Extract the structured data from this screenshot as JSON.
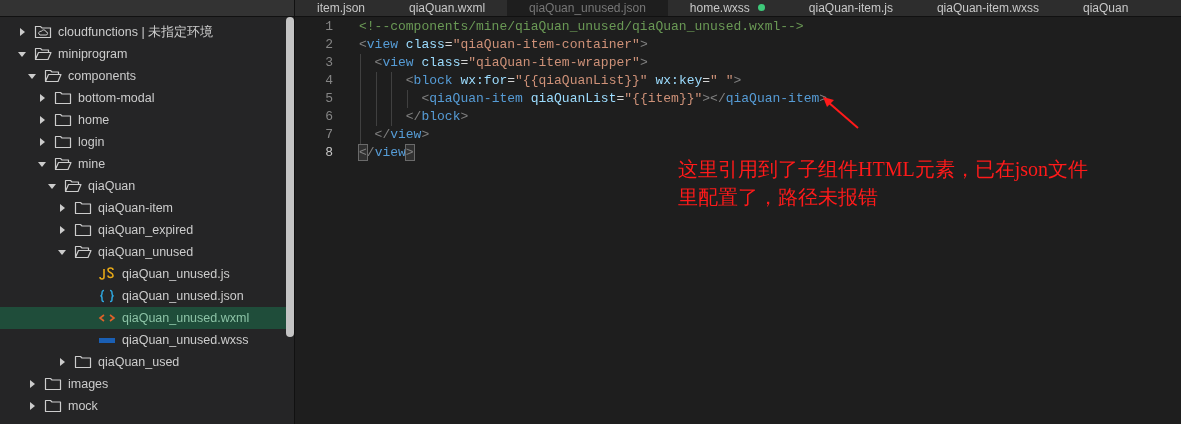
{
  "editor_tabs": [
    {
      "label": "item.json",
      "selected": false,
      "modified": false
    },
    {
      "label": "qiaQuan.wxml",
      "selected": false,
      "modified": false
    },
    {
      "label": "qiaQuan_unused.json",
      "selected": true,
      "modified": false
    },
    {
      "label": "home.wxss",
      "selected": false,
      "modified": true
    },
    {
      "label": "qiaQuan-item.js",
      "selected": false,
      "modified": false
    },
    {
      "label": "qiaQuan-item.wxss",
      "selected": false,
      "modified": false
    },
    {
      "label": "qiaQuan",
      "selected": false,
      "modified": false
    }
  ],
  "file_tree": [
    {
      "label": "cloudfunctions | 未指定环境",
      "kind": "cloud_folder",
      "expanded": false,
      "selected": false
    },
    {
      "label": "miniprogram",
      "kind": "folder",
      "expanded": true,
      "selected": false,
      "children": [
        {
          "label": "components",
          "kind": "folder",
          "expanded": true,
          "selected": false,
          "children": [
            {
              "label": "bottom-modal",
              "kind": "folder",
              "expanded": false,
              "selected": false
            },
            {
              "label": "home",
              "kind": "folder",
              "expanded": false,
              "selected": false
            },
            {
              "label": "login",
              "kind": "folder",
              "expanded": false,
              "selected": false
            },
            {
              "label": "mine",
              "kind": "folder",
              "expanded": true,
              "selected": false,
              "children": [
                {
                  "label": "qiaQuan",
                  "kind": "folder",
                  "expanded": true,
                  "selected": false,
                  "children": [
                    {
                      "label": "qiaQuan-item",
                      "kind": "folder",
                      "expanded": false,
                      "selected": false
                    },
                    {
                      "label": "qiaQuan_expired",
                      "kind": "folder",
                      "expanded": false,
                      "selected": false
                    },
                    {
                      "label": "qiaQuan_unused",
                      "kind": "folder",
                      "expanded": true,
                      "selected": false,
                      "children": [
                        {
                          "label": "qiaQuan_unused.js",
                          "kind": "js",
                          "selected": false
                        },
                        {
                          "label": "qiaQuan_unused.json",
                          "kind": "json",
                          "selected": false
                        },
                        {
                          "label": "qiaQuan_unused.wxml",
                          "kind": "wxml",
                          "selected": true
                        },
                        {
                          "label": "qiaQuan_unused.wxss",
                          "kind": "wxss",
                          "selected": false
                        }
                      ]
                    },
                    {
                      "label": "qiaQuan_used",
                      "kind": "folder",
                      "expanded": false,
                      "selected": false
                    }
                  ]
                }
              ]
            }
          ]
        },
        {
          "label": "images",
          "kind": "folder",
          "expanded": false,
          "selected": false
        },
        {
          "label": "mock",
          "kind": "folder",
          "expanded": false,
          "selected": false
        }
      ]
    }
  ],
  "code_lines": [
    {
      "number": "1",
      "current": false,
      "tokens": [
        {
          "kind": "comment",
          "text": "<!--components/mine/qiaQuan_unused/qiaQuan_unused.wxml-->"
        }
      ]
    },
    {
      "number": "2",
      "current": false,
      "tokens": [
        {
          "kind": "punct",
          "text": "<"
        },
        {
          "kind": "tag",
          "text": "view"
        },
        {
          "kind": "attr",
          "text": " class"
        },
        {
          "kind": "plain",
          "text": "="
        },
        {
          "kind": "string",
          "text": "\"qiaQuan-item-container\""
        },
        {
          "kind": "punct",
          "text": ">"
        }
      ]
    },
    {
      "number": "3",
      "current": false,
      "tokens": [
        {
          "kind": "punct",
          "text": "  <"
        },
        {
          "kind": "tag",
          "text": "view"
        },
        {
          "kind": "attr",
          "text": " class"
        },
        {
          "kind": "plain",
          "text": "="
        },
        {
          "kind": "string",
          "text": "\"qiaQuan-item-wrapper\""
        },
        {
          "kind": "punct",
          "text": ">"
        }
      ]
    },
    {
      "number": "4",
      "current": false,
      "tokens": [
        {
          "kind": "punct",
          "text": "      <"
        },
        {
          "kind": "tag",
          "text": "block"
        },
        {
          "kind": "attr",
          "text": " wx:for"
        },
        {
          "kind": "plain",
          "text": "="
        },
        {
          "kind": "string",
          "text": "\"{{qiaQuanList}}\""
        },
        {
          "kind": "attr",
          "text": " wx:key"
        },
        {
          "kind": "plain",
          "text": "="
        },
        {
          "kind": "string",
          "text": "\" \""
        },
        {
          "kind": "punct",
          "text": ">"
        }
      ]
    },
    {
      "number": "5",
      "current": false,
      "tokens": [
        {
          "kind": "punct",
          "text": "        <"
        },
        {
          "kind": "tag",
          "text": "qiaQuan-item"
        },
        {
          "kind": "attr",
          "text": " qiaQuanList"
        },
        {
          "kind": "plain",
          "text": "="
        },
        {
          "kind": "string",
          "text": "\"{{item}}\""
        },
        {
          "kind": "punct",
          "text": "></"
        },
        {
          "kind": "tag",
          "text": "qiaQuan-item"
        },
        {
          "kind": "punct",
          "text": ">"
        }
      ]
    },
    {
      "number": "6",
      "current": false,
      "tokens": [
        {
          "kind": "punct",
          "text": "      </"
        },
        {
          "kind": "tag",
          "text": "block"
        },
        {
          "kind": "punct",
          "text": ">"
        }
      ]
    },
    {
      "number": "7",
      "current": false,
      "tokens": [
        {
          "kind": "punct",
          "text": "  </"
        },
        {
          "kind": "tag",
          "text": "view"
        },
        {
          "kind": "punct",
          "text": ">"
        }
      ]
    },
    {
      "number": "8",
      "current": true,
      "tokens": [
        {
          "kind": "punct",
          "text": "<",
          "matched": true
        },
        {
          "kind": "punct",
          "text": "/"
        },
        {
          "kind": "tag",
          "text": "view"
        },
        {
          "kind": "punct",
          "text": ">",
          "matched": true
        }
      ]
    }
  ],
  "annotation": {
    "lines": [
      "这里引用到了子组件HTML元素，已在json文件",
      "里配置了，路径未报错"
    ]
  }
}
